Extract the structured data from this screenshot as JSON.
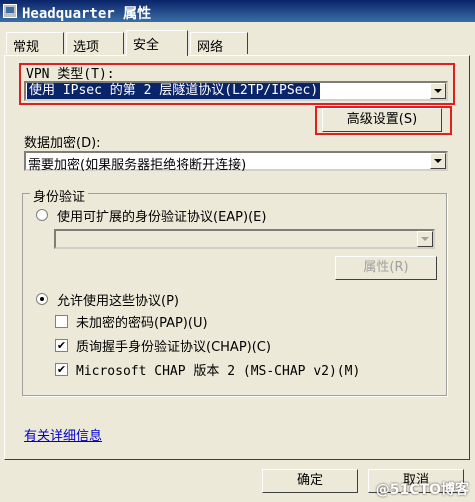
{
  "window": {
    "title": "Headquarter 属性"
  },
  "tabs": [
    {
      "label": "常规"
    },
    {
      "label": "选项"
    },
    {
      "label": "安全"
    },
    {
      "label": "网络"
    }
  ],
  "vpn": {
    "label": "VPN 类型(T):",
    "value": "使用 IPsec 的第 2 层隧道协议(L2TP/IPSec)",
    "advanced_button": "高级设置(S)"
  },
  "encryption": {
    "label": "数据加密(D):",
    "value": "需要加密(如果服务器拒绝将断开连接)"
  },
  "auth": {
    "group_label": "身份验证",
    "eap_radio": "使用可扩展的身份验证协议(EAP)(E)",
    "eap_selected": false,
    "eap_select_value": "",
    "properties_button": "属性(R)",
    "protocols_radio": "允许使用这些协议(P)",
    "protocols_selected": true,
    "checks": [
      {
        "label": "未加密的密码(PAP)(U)",
        "checked": false
      },
      {
        "label": "质询握手身份验证协议(CHAP)(C)",
        "checked": true
      },
      {
        "label": "Microsoft CHAP 版本 2 (MS-CHAP v2)(M)",
        "checked": true
      }
    ]
  },
  "more_info_link": "有关详细信息",
  "footer": {
    "ok": "确定",
    "cancel": "取消"
  },
  "watermark": "@51CTO博客",
  "colors": {
    "highlight": "#e02020",
    "selection": "#0a246a",
    "title_bar": "#0a246a"
  }
}
